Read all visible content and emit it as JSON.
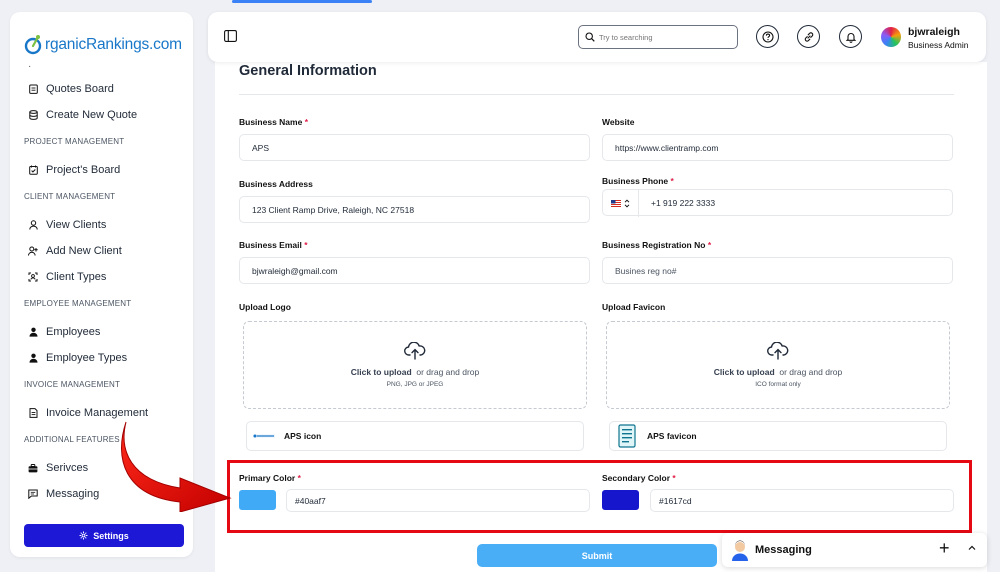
{
  "app": {
    "logo_text": "rganicRankings.com"
  },
  "sidebar": {
    "items": [
      {
        "label": "Quotes Board",
        "icon": "clipboard-icon"
      },
      {
        "label": "Create New Quote",
        "icon": "database-icon"
      },
      {
        "section": "PROJECT MANAGEMENT"
      },
      {
        "label": "Project's Board",
        "icon": "calendar-check-icon"
      },
      {
        "section": "CLIENT MANAGEMENT"
      },
      {
        "label": "View Clients",
        "icon": "user-icon"
      },
      {
        "label": "Add New Client",
        "icon": "user-plus-icon"
      },
      {
        "label": "Client Types",
        "icon": "user-square-icon"
      },
      {
        "section": "EMPLOYEE MANAGEMENT"
      },
      {
        "label": "Employees",
        "icon": "user-solid-icon"
      },
      {
        "label": "Employee Types",
        "icon": "user-solid-icon"
      },
      {
        "section": "INVOICE MANAGEMENT"
      },
      {
        "label": "Invoice Management",
        "icon": "document-icon"
      },
      {
        "section": "ADDITIONAL FEATURES"
      },
      {
        "label": "Serivces",
        "icon": "services-icon"
      },
      {
        "label": "Messaging",
        "icon": "chat-icon"
      }
    ],
    "settings_label": "Settings"
  },
  "header": {
    "search_placeholder": "Try to searching",
    "user_name": "bjwraleigh",
    "user_role": "Business Admin"
  },
  "form": {
    "title": "General Information",
    "business_name": {
      "label": "Business Name",
      "required": "*",
      "value": "APS"
    },
    "website": {
      "label": "Website",
      "value": "https://www.clientramp.com"
    },
    "business_address": {
      "label": "Business Address",
      "value": "123 Client Ramp Drive, Raleigh, NC 27518"
    },
    "business_phone": {
      "label": "Business Phone",
      "required": "*",
      "value": "+1 919 222 3333"
    },
    "business_email": {
      "label": "Business Email",
      "required": "*",
      "value": "bjwraleigh@gmail.com"
    },
    "registration_no": {
      "label": "Business Registration No",
      "required": "*",
      "placeholder": "Busines reg no#"
    },
    "upload_logo": {
      "label": "Upload Logo",
      "click": "Click to upload",
      "drag": "or drag and drop",
      "hint": "PNG, JPG or JPEG",
      "file_name": "APS icon"
    },
    "upload_favicon": {
      "label": "Upload Favicon",
      "click": "Click to upload",
      "drag": "or drag and drop",
      "hint": "ICO format only",
      "file_name": "APS favicon"
    },
    "primary_color": {
      "label": "Primary Color",
      "required": "*",
      "value": "#40aaf7"
    },
    "secondary_color": {
      "label": "Secondary Color",
      "required": "*",
      "value": "#1617cd"
    },
    "submit_label": "Submit"
  },
  "messaging_widget": {
    "label": "Messaging"
  },
  "colors": {
    "primary": "#40aaf7",
    "secondary": "#1617cd",
    "settings_button": "#1d18d6",
    "highlight": "#e50914"
  }
}
